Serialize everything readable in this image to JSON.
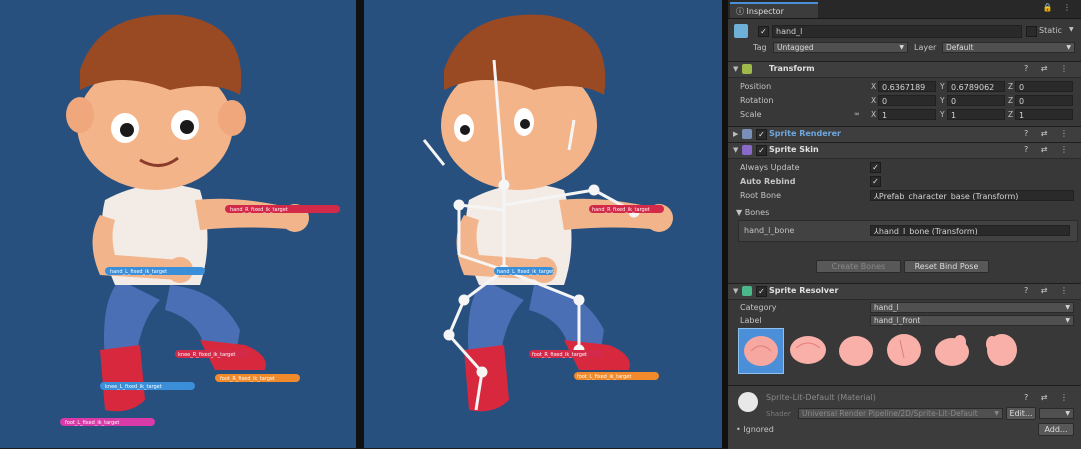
{
  "scene": {
    "left_labels": [
      "hand_R_fixed_ik_target",
      "hand_L_fixed_ik_target",
      "foot_R_fixed_ik_target",
      "foot_L_fixed_ik_target",
      "knee_R_fixed_ik_target",
      "knee_L_fixed_ik_target"
    ],
    "right_labels": [
      "hand_R_fixed_ik_target",
      "hand_L_fixed_ik_target",
      "foot_R_fixed_ik_target",
      "foot_L_fixed_ik_target"
    ]
  },
  "inspector": {
    "tab_title": "Inspector",
    "object_name": "hand_l",
    "static_label": "Static",
    "tag_label": "Tag",
    "tag_value": "Untagged",
    "layer_label": "Layer",
    "layer_value": "Default",
    "transform": {
      "title": "Transform",
      "position_label": "Position",
      "rotation_label": "Rotation",
      "scale_label": "Scale",
      "position": [
        "0.6367189",
        "0.6789062",
        "0"
      ],
      "rotation": [
        "0",
        "0",
        "0"
      ],
      "scale": [
        "1",
        "1",
        "1"
      ],
      "x": "X",
      "y": "Y",
      "z": "Z"
    },
    "sprite_renderer": {
      "title": "Sprite Renderer"
    },
    "sprite_skin": {
      "title": "Sprite Skin",
      "always_update": "Always Update",
      "auto_rebind": "Auto Rebind",
      "root_bone_label": "Root Bone",
      "root_bone_value": "Prefab_character_base (Transform)",
      "bones_label": "Bones",
      "bone_name": "hand_l_bone",
      "bone_value": "hand_l_bone (Transform)",
      "create_bones": "Create Bones",
      "reset_bind_pose": "Reset Bind Pose"
    },
    "sprite_resolver": {
      "title": "Sprite Resolver",
      "category_label": "Category",
      "category_value": "hand_l",
      "label_label": "Label",
      "label_value": "hand_l_front"
    },
    "material": {
      "name": "Sprite-Lit-Default (Material)",
      "shader_label": "Shader",
      "shader_value": "Universal Render Pipeline/2D/Sprite-Lit-Default",
      "edit": "Edit...",
      "ignored": "Ignored",
      "add": "Add..."
    }
  }
}
